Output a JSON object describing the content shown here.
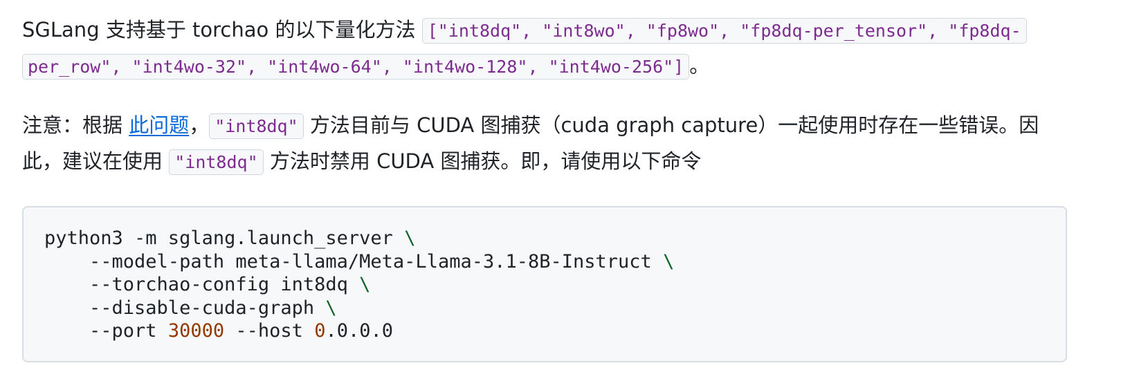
{
  "para1": {
    "intro": "SGLang 支持基于 torchao 的以下量化方法 ",
    "methods_code": "[\"int8dq\", \"int8wo\", \"fp8wo\", \"fp8dq-per_tensor\", \"fp8dq-per_row\", \"int4wo-32\", \"int4wo-64\", \"int4wo-128\", \"int4wo-256\"]",
    "end": "。"
  },
  "para2": {
    "prefix": "注意：根据 ",
    "link": "此问题",
    "after_link": "，",
    "code1": "\"int8dq\"",
    "mid1": " 方法目前与 CUDA 图捕获（cuda graph capture）一起使用时存在一些错误。因此，建议在使用 ",
    "code2": "\"int8dq\"",
    "mid2": " 方法时禁用 CUDA 图捕获。即，请使用以下命令"
  },
  "code": {
    "l1_cmd": "python3 -m sglang.launch_server",
    "l2_cmd": "    --model-path meta-llama/Meta-Llama-3.1-8B-Instruct",
    "l3_cmd": "    --torchao-config int8dq",
    "l4_cmd": "    --disable-cuda-graph",
    "l5_port_flag": "    --port",
    "l5_port_value": "30000",
    "l5_host_flag": "--host",
    "l5_host_lead": "0",
    "l5_host_rest": ".0.0.0",
    "continuation": "\\"
  },
  "colors": {
    "text": "#1f2328",
    "inline_code": "#7d2b8f",
    "link": "#0969da",
    "code_bg": "#f6f8fa",
    "continuation": "#116329",
    "number": "#953800"
  }
}
